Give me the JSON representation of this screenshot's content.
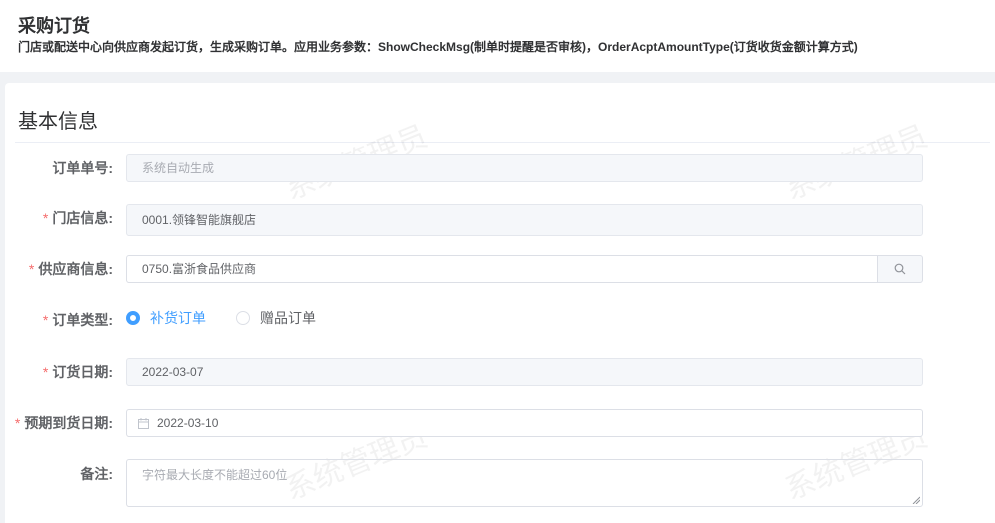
{
  "header": {
    "title": "采购订货",
    "description": "门店或配送中心向供应商发起订货，生成采购订单。应用业务参数：ShowCheckMsg(制单时提醒是否审核)，OrderAcptAmountType(订货收货金额计算方式)"
  },
  "section": {
    "title": "基本信息"
  },
  "form": {
    "order_no": {
      "label": "订单单号:",
      "placeholder": "系统自动生成"
    },
    "store": {
      "label": "门店信息:",
      "value": "0001.领锋智能旗舰店"
    },
    "supplier": {
      "label": "供应商信息:",
      "value": "0750.富浙食品供应商"
    },
    "order_type": {
      "label": "订单类型:",
      "options": [
        "补货订单",
        "赠品订单"
      ],
      "selected": "补货订单"
    },
    "order_date": {
      "label": "订货日期:",
      "value": "2022-03-07"
    },
    "expected_date": {
      "label": "预期到货日期:",
      "value": "2022-03-10"
    },
    "remark": {
      "label": "备注:",
      "placeholder": "字符最大长度不能超过60位"
    }
  },
  "watermark": {
    "text": "系统管理员"
  },
  "colors": {
    "accent": "#409eff",
    "required": "#f56c6c",
    "border": "#dcdfe6",
    "disabled_bg": "#f5f7fa"
  },
  "icons": {
    "supplier_search": "search-icon",
    "date_picker": "calendar-icon"
  }
}
